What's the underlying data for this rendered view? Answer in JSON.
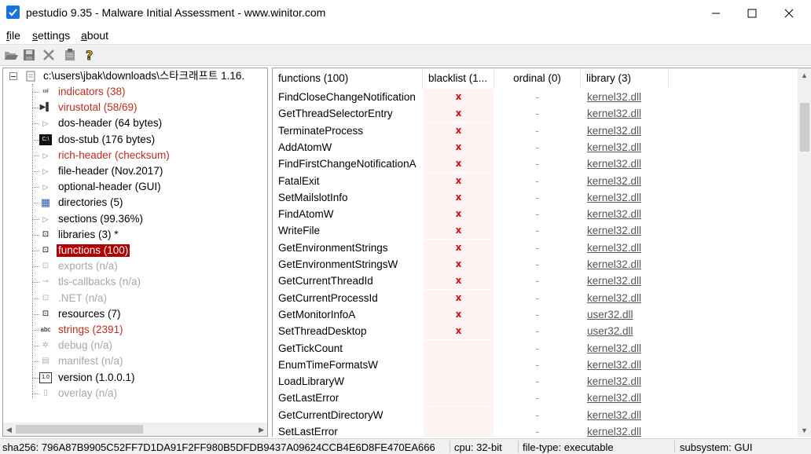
{
  "window": {
    "title": "pestudio 9.35 - Malware Initial Assessment - www.winitor.com"
  },
  "menu": {
    "items": [
      {
        "label": "file"
      },
      {
        "label": "settings"
      },
      {
        "label": "about"
      }
    ]
  },
  "toolbar": {
    "icons": [
      "open-icon",
      "save-icon",
      "close-file-icon",
      "clipboard-icon",
      "help-icon"
    ]
  },
  "tree": {
    "root": "c:\\users\\jbak\\downloads\\스타크래프트 1.16.",
    "items": [
      {
        "label": "indicators (38)",
        "style": "red",
        "icon": "indicators-icon",
        "glyph": "ıııl"
      },
      {
        "label": "virustotal (58/69)",
        "style": "red",
        "icon": "virustotal-icon",
        "glyph": "▶▌"
      },
      {
        "label": "dos-header (64 bytes)",
        "style": "normal",
        "icon": "expand-icon",
        "glyph": "▷"
      },
      {
        "label": "dos-stub (176 bytes)",
        "style": "normal",
        "icon": "console-icon",
        "glyph": "C:\\"
      },
      {
        "label": "rich-header (checksum)",
        "style": "red",
        "icon": "expand-icon",
        "glyph": "▷"
      },
      {
        "label": "file-header (Nov.2017)",
        "style": "normal",
        "icon": "expand-icon",
        "glyph": "▷"
      },
      {
        "label": "optional-header (GUI)",
        "style": "normal",
        "icon": "expand-icon",
        "glyph": "▷"
      },
      {
        "label": "directories (5)",
        "style": "normal",
        "icon": "directories-icon",
        "glyph": "▦"
      },
      {
        "label": "sections (99.36%)",
        "style": "normal",
        "icon": "expand-icon",
        "glyph": "▷"
      },
      {
        "label": "libraries (3) *",
        "style": "normal",
        "icon": "libraries-icon",
        "glyph": "⊡"
      },
      {
        "label": "functions (100)",
        "style": "selected",
        "icon": "functions-icon",
        "glyph": "⊡"
      },
      {
        "label": "exports (n/a)",
        "style": "gray",
        "icon": "exports-icon",
        "glyph": "⊡"
      },
      {
        "label": "tls-callbacks (n/a)",
        "style": "gray",
        "icon": "key-icon",
        "glyph": "⊸"
      },
      {
        "label": ".NET (n/a)",
        "style": "gray",
        "icon": "dotnet-icon",
        "glyph": "⊡"
      },
      {
        "label": "resources (7)",
        "style": "normal",
        "icon": "resources-icon",
        "glyph": "⊡"
      },
      {
        "label": "strings (2391)",
        "style": "red",
        "icon": "strings-icon",
        "glyph": "abc"
      },
      {
        "label": "debug (n/a)",
        "style": "gray",
        "icon": "bug-icon",
        "glyph": "✲"
      },
      {
        "label": "manifest (n/a)",
        "style": "gray",
        "icon": "manifest-icon",
        "glyph": "▤"
      },
      {
        "label": "version (1.0.0.1)",
        "style": "normal",
        "icon": "version-icon",
        "glyph": "1.0"
      },
      {
        "label": "overlay (n/a)",
        "style": "gray",
        "icon": "overlay-icon",
        "glyph": "▯"
      }
    ]
  },
  "grid": {
    "columns": [
      {
        "label": "functions (100)"
      },
      {
        "label": "blacklist (1..."
      },
      {
        "label": "ordinal (0)"
      },
      {
        "label": "library (3)"
      }
    ],
    "rows": [
      {
        "function": "FindCloseChangeNotification",
        "blacklist": "x",
        "ordinal": "-",
        "library": "kernel32.dll"
      },
      {
        "function": "GetThreadSelectorEntry",
        "blacklist": "x",
        "ordinal": "-",
        "library": "kernel32.dll"
      },
      {
        "function": "TerminateProcess",
        "blacklist": "x",
        "ordinal": "-",
        "library": "kernel32.dll"
      },
      {
        "function": "AddAtomW",
        "blacklist": "x",
        "ordinal": "-",
        "library": "kernel32.dll"
      },
      {
        "function": "FindFirstChangeNotificationA",
        "blacklist": "x",
        "ordinal": "-",
        "library": "kernel32.dll"
      },
      {
        "function": "FatalExit",
        "blacklist": "x",
        "ordinal": "-",
        "library": "kernel32.dll"
      },
      {
        "function": "SetMailslotInfo",
        "blacklist": "x",
        "ordinal": "-",
        "library": "kernel32.dll"
      },
      {
        "function": "FindAtomW",
        "blacklist": "x",
        "ordinal": "-",
        "library": "kernel32.dll"
      },
      {
        "function": "WriteFile",
        "blacklist": "x",
        "ordinal": "-",
        "library": "kernel32.dll"
      },
      {
        "function": "GetEnvironmentStrings",
        "blacklist": "x",
        "ordinal": "-",
        "library": "kernel32.dll"
      },
      {
        "function": "GetEnvironmentStringsW",
        "blacklist": "x",
        "ordinal": "-",
        "library": "kernel32.dll"
      },
      {
        "function": "GetCurrentThreadId",
        "blacklist": "x",
        "ordinal": "-",
        "library": "kernel32.dll"
      },
      {
        "function": "GetCurrentProcessId",
        "blacklist": "x",
        "ordinal": "-",
        "library": "kernel32.dll"
      },
      {
        "function": "GetMonitorInfoA",
        "blacklist": "x",
        "ordinal": "-",
        "library": "user32.dll"
      },
      {
        "function": "SetThreadDesktop",
        "blacklist": "x",
        "ordinal": "-",
        "library": "user32.dll"
      },
      {
        "function": "GetTickCount",
        "blacklist": "",
        "ordinal": "-",
        "library": "kernel32.dll"
      },
      {
        "function": "EnumTimeFormatsW",
        "blacklist": "",
        "ordinal": "-",
        "library": "kernel32.dll"
      },
      {
        "function": "LoadLibraryW",
        "blacklist": "",
        "ordinal": "-",
        "library": "kernel32.dll"
      },
      {
        "function": "GetLastError",
        "blacklist": "",
        "ordinal": "-",
        "library": "kernel32.dll"
      },
      {
        "function": "GetCurrentDirectoryW",
        "blacklist": "",
        "ordinal": "-",
        "library": "kernel32.dll"
      },
      {
        "function": "SetLastError",
        "blacklist": "",
        "ordinal": "-",
        "library": "kernel32.dll"
      }
    ]
  },
  "status": {
    "sha256": "sha256: 796A87B9905C52FF7D1DA91F2FF980B5DFDB9437A09624CCB4E6D8FE470EA666",
    "cpu": "cpu: 32-bit",
    "filetype": "file-type: executable",
    "subsystem": "subsystem: GUI"
  },
  "colors": {
    "accent": "#1a73d9",
    "selected": "#b00000",
    "red_text": "#c42b1c",
    "blacklist_x": "#d01010"
  }
}
